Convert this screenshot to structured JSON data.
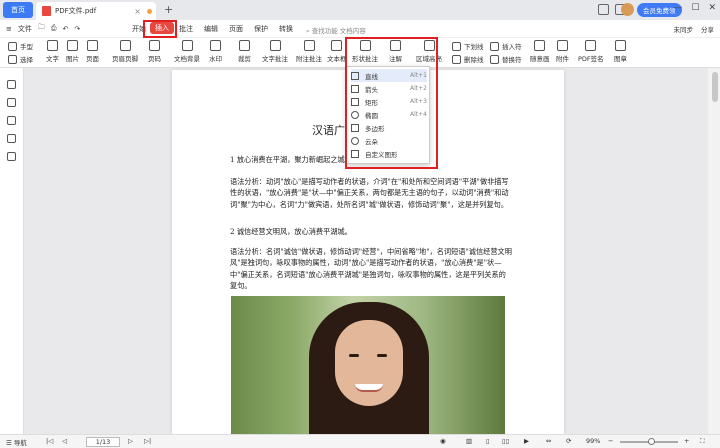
{
  "titlebar": {
    "home_tab": "首页",
    "doc_tab": "PDF文件.pdf",
    "vip_label": "会员免费领"
  },
  "menubar": {
    "file_label": "文件",
    "tabs": [
      "开始",
      "插入",
      "批注",
      "编辑",
      "页面",
      "保护",
      "转换"
    ],
    "active_tab": "插入",
    "search_placeholder": "查找功能",
    "search2": "文档内容",
    "right": [
      "未同步",
      "分享"
    ]
  },
  "toolbar": {
    "items": [
      "手型",
      "选择",
      "文字",
      "图片",
      "页面",
      "页眉页脚",
      "页码",
      "文档背景",
      "水印",
      "裁剪",
      "文字批注",
      "附注批注",
      "文本框",
      "形状批注",
      "注解",
      "区域高亮",
      "下划线",
      "插入符",
      "删除线",
      "替换符",
      "随意画",
      "附件",
      "PDF签名",
      "图章"
    ]
  },
  "dropdown": {
    "items": [
      {
        "label": "直线",
        "shortcut": "Alt+1"
      },
      {
        "label": "箭头",
        "shortcut": "Alt+2"
      },
      {
        "label": "矩形",
        "shortcut": "Alt+3"
      },
      {
        "label": "椭圆",
        "shortcut": "Alt+4"
      },
      {
        "label": "多边形",
        "shortcut": ""
      },
      {
        "label": "云朵",
        "shortcut": ""
      },
      {
        "label": "自定义图形",
        "shortcut": ""
      }
    ]
  },
  "document": {
    "title": "汉语广告",
    "para1": "1  放心消费在平湖，聚力新崛起之城",
    "para2": "语法分析：动词\"放心\"是描写动作者的状语，介词\"在\"和处所和空间词语\"平湖\"做非描写性的状语，\"放心消费\"是\"状—中\"偏正关系，两句都是无主语的句子，以动词\"消费\"和动词\"聚\"为中心，名词\"力\"做宾语，处所名词\"城\"做状语，修饰动词\"聚\"，这是并列复句。",
    "para3": "2  诚信经营文明风，放心消费平湖城。",
    "para4": "语法分析：名词\"诚信\"做状语，修饰动词\"经营\"，中间省略\"地\"，名词短语\"诚信经营文明风\"是独词句，咏叹事物的属性，动词\"放心\"是描写动作者的状语，\"放心消费\"是\"状—中\"偏正关系，名词短语\"放心消费平湖城\"是独词句，咏叹事物的属性，这是平列关系的复句。"
  },
  "statusbar": {
    "nav": "导航",
    "page": "1/13",
    "zoom": "99%"
  }
}
